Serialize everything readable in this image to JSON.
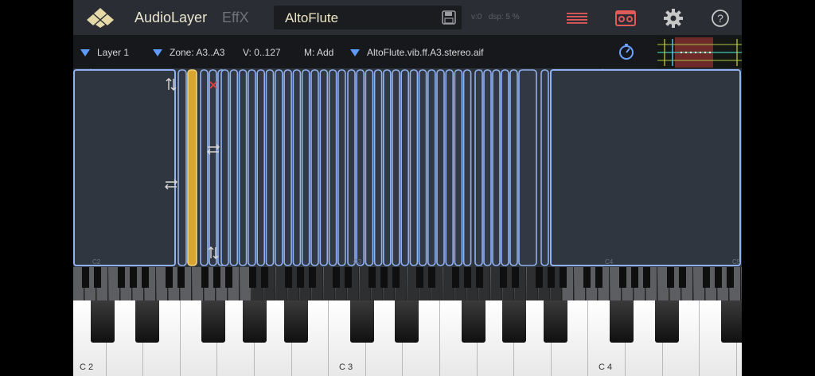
{
  "app": {
    "name": "AudioLayer",
    "effx_label": "EffX"
  },
  "preset": {
    "name": "AltoFlute"
  },
  "status": {
    "voices": "v:0",
    "dsp": "dsp: 5 %"
  },
  "icons": {
    "logo": "diamond-logo-icon",
    "save": "floppy-disk-icon",
    "menu": "hamburger-menu-icon",
    "recorder": "tape-recorder-icon",
    "settings": "gear-icon",
    "help": "question-mark-icon",
    "tune": "tuner-dial-icon"
  },
  "layerbar": {
    "layer": "Layer 1",
    "zone": "Zone: A3..A3",
    "velocity": "V: 0..127",
    "mode": "M: Add",
    "sample": "AltoFlute.vib.ff.A3.stereo.aif"
  },
  "zone_labels": [
    "C2",
    "C3",
    "C4",
    "C5"
  ],
  "keyboard": {
    "octave_labels": [
      "C 2",
      "C 3",
      "C 4"
    ]
  },
  "colors": {
    "accent": "#d9a531",
    "zone_outline": "#8fb2f2",
    "menu_red": "#e05a5a",
    "layer_triangle": "#5f9bff"
  }
}
